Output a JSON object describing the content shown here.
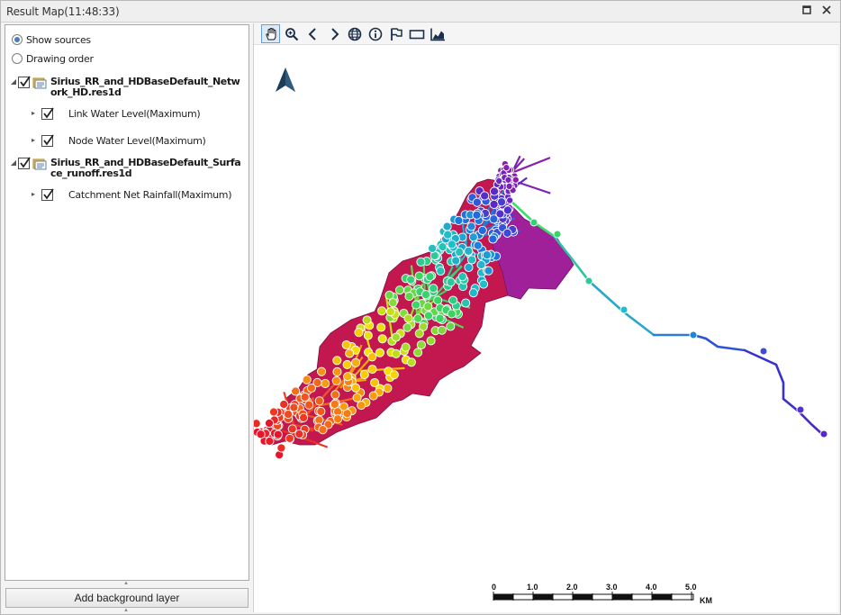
{
  "window": {
    "title": "Result Map(11:48:33)",
    "controls": {
      "restore": "▫",
      "close": "✕"
    }
  },
  "left_panel": {
    "modes": [
      {
        "label": "Show sources",
        "selected": true
      },
      {
        "label": "Drawing order",
        "selected": false
      }
    ],
    "sources": [
      {
        "name": "Sirius_RR_and_HDBaseDefault_Network_HD.res1d",
        "checked": true,
        "expanded": true,
        "items": [
          {
            "label": "Link Water Level(Maximum)",
            "checked": true
          },
          {
            "label": "Node Water Level(Maximum)",
            "checked": true
          }
        ]
      },
      {
        "name": "Sirius_RR_and_HDBaseDefault_Surface_runoff.res1d",
        "checked": true,
        "expanded": true,
        "items": [
          {
            "label": "Catchment Net Rainfall(Maximum)",
            "checked": true
          }
        ]
      }
    ],
    "add_background_label": "Add background layer"
  },
  "toolbar": {
    "tools": [
      {
        "name": "pan-icon",
        "active": true
      },
      {
        "name": "zoom-icon",
        "active": false
      },
      {
        "name": "back-icon",
        "active": false
      },
      {
        "name": "forward-icon",
        "active": false
      },
      {
        "name": "globe-icon",
        "active": false
      },
      {
        "name": "info-icon",
        "active": false
      },
      {
        "name": "flag-icon",
        "active": false
      },
      {
        "name": "rectangle-icon",
        "active": false
      },
      {
        "name": "chart-icon",
        "active": false
      }
    ]
  },
  "map": {
    "catchment_color": "#c2174f",
    "catchment_color_upper": "#a0209a",
    "colors": {
      "low": "#e8142b",
      "mid_low": "#f7e300",
      "mid": "#35d27a",
      "mid_high": "#1e6fe0",
      "high": "#7a1fb5"
    },
    "scale_bar": {
      "ticks": [
        "0",
        "1.0",
        "2.0",
        "3.0",
        "4.0",
        "5.0"
      ],
      "unit": "KM"
    },
    "north_arrow": "north-arrow-icon"
  }
}
